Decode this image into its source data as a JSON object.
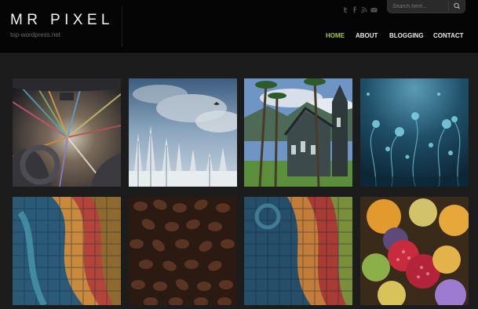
{
  "site": {
    "title": "MR PIXEL",
    "subtitle": "top-wordpress.net"
  },
  "search": {
    "placeholder": "Search here..."
  },
  "social_icons": [
    "twitter-icon",
    "facebook-icon",
    "rss-icon",
    "email-icon"
  ],
  "nav": {
    "items": [
      {
        "label": "HOME",
        "active": true
      },
      {
        "label": "ABOUT",
        "active": false
      },
      {
        "label": "BLOGGING",
        "active": false
      },
      {
        "label": "CONTACT",
        "active": false
      }
    ]
  },
  "colors": {
    "accent": "#a3c932",
    "header_bg": "#050505",
    "page_bg": "#1c1c1c"
  },
  "gallery": {
    "tiles": [
      {
        "subject": "car-interior-light-trails"
      },
      {
        "subject": "snowy-winter-forest"
      },
      {
        "subject": "wooden-church-with-palms"
      },
      {
        "subject": "blue-floral-swirls"
      },
      {
        "subject": "colorful-mosaic"
      },
      {
        "subject": "coffee-beans"
      },
      {
        "subject": "colorful-mosaic-2"
      },
      {
        "subject": "fresh-fruit"
      }
    ]
  }
}
